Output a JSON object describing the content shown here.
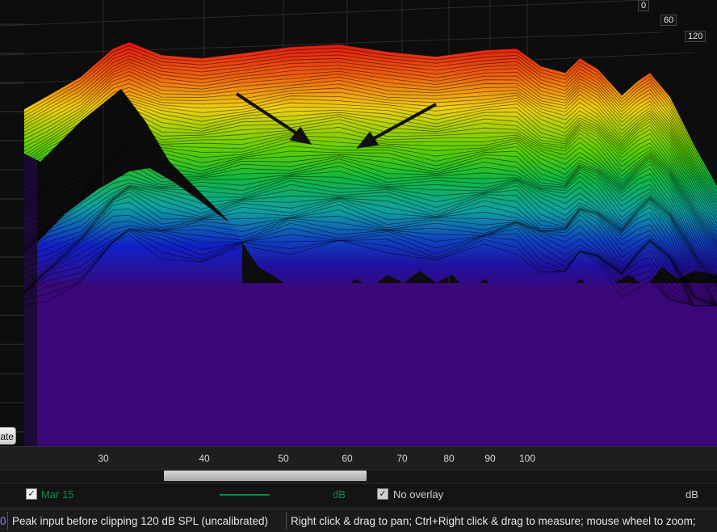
{
  "plot": {
    "z_axis_labels": [
      "0",
      "60",
      "120"
    ]
  },
  "update_button": {
    "label": "ate"
  },
  "x_axis": {
    "ticks": [
      "30",
      "40",
      "50",
      "60",
      "70",
      "80",
      "90",
      "100"
    ]
  },
  "legend": {
    "measurement": {
      "checked": true,
      "name": "Mar 15",
      "unit": "dB",
      "color": "#0f8a4a"
    },
    "overlay": {
      "checked": true,
      "name": "No overlay",
      "unit": "dB"
    }
  },
  "status_bar": {
    "left_stub": "0",
    "peak_input": "Peak input before clipping 120 dB SPL (uncalibrated)",
    "hint": "Right click & drag to pan; Ctrl+Right click & drag to measure; mouse wheel to zoom;"
  },
  "colors": {
    "waterfall_top": "#e01010",
    "waterfall_mid": "#22c000",
    "waterfall_floor": "#3a0878",
    "arrow": "#111111"
  }
}
